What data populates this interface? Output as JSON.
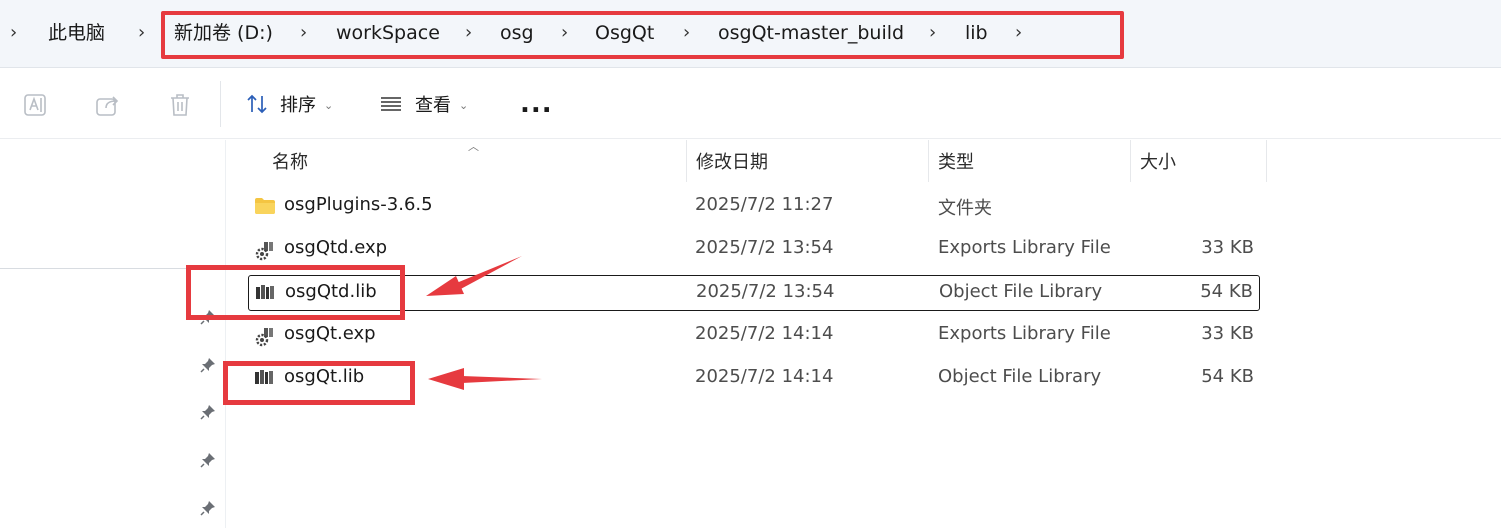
{
  "breadcrumb": {
    "root": "此电脑",
    "items": [
      "新加卷 (D:)",
      "workSpace",
      "osg",
      "OsgQt",
      "osgQt-master_build",
      "lib"
    ]
  },
  "toolbar": {
    "sort_label": "排序",
    "view_label": "查看",
    "more_label": "..."
  },
  "columns": {
    "name": "名称",
    "modified": "修改日期",
    "type": "类型",
    "size": "大小"
  },
  "files": [
    {
      "name": "osgPlugins-3.6.5",
      "modified": "2025/7/2 11:27",
      "type": "文件夹",
      "size": "",
      "icon": "folder-icon"
    },
    {
      "name": "osgQtd.exp",
      "modified": "2025/7/2 13:54",
      "type": "Exports Library File",
      "size": "33 KB",
      "icon": "exp-file-icon"
    },
    {
      "name": "osgQtd.lib",
      "modified": "2025/7/2 13:54",
      "type": "Object File Library",
      "size": "54 KB",
      "icon": "lib-file-icon"
    },
    {
      "name": "osgQt.exp",
      "modified": "2025/7/2 14:14",
      "type": "Exports Library File",
      "size": "33 KB",
      "icon": "exp-file-icon"
    },
    {
      "name": "osgQt.lib",
      "modified": "2025/7/2 14:14",
      "type": "Object File Library",
      "size": "54 KB",
      "icon": "lib-file-icon"
    }
  ],
  "selected_file": "osgQtd.lib",
  "colors": {
    "annotation_red": "#e63a3f",
    "folder_yellow": "#f4c542",
    "address_bg": "#f3f6fa"
  }
}
